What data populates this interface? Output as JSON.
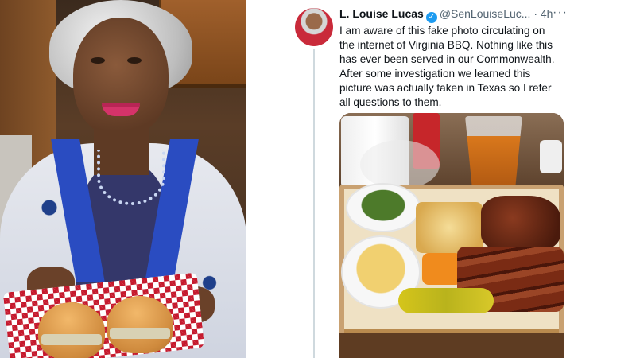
{
  "tweet": {
    "author_name": "L. Louise Lucas",
    "handle": "@SenLouiseLuc...",
    "time_sep": "·",
    "time": "4h",
    "more_glyph": "···",
    "verified_glyph": "✓",
    "body_lines": [
      "I am aware of this fake photo circulating on",
      "the internet of Virginia BBQ.  Nothing like this",
      "has ever been served in our Commonwealth.",
      "After some investigation we learned this",
      "picture was actually taken in Texas so I refer",
      "all questions to them."
    ]
  },
  "colors": {
    "verified": "#1d9bf0",
    "text_primary": "#0f1419",
    "text_secondary": "#536471",
    "thread_line": "#cfd9de"
  },
  "icons": {
    "verified": "verified-badge-icon",
    "more": "more-options-icon"
  }
}
